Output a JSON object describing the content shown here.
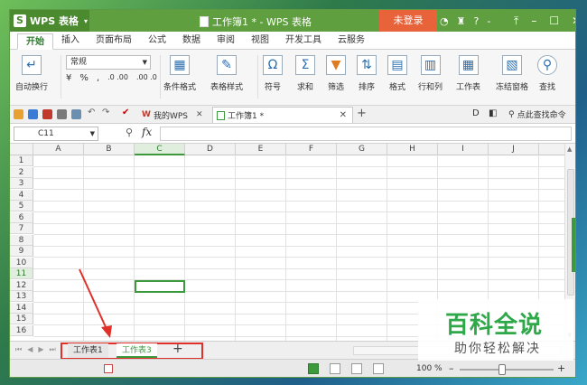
{
  "app": {
    "name": "WPS 表格",
    "logo": "S"
  },
  "title": {
    "text": "工作簿1 * - WPS 表格"
  },
  "login_button": "未登录",
  "title_icons": [
    "?",
    "-"
  ],
  "tabs": [
    "开始",
    "插入",
    "页面布局",
    "公式",
    "数据",
    "审阅",
    "视图",
    "开发工具",
    "云服务"
  ],
  "ribbon": {
    "wrap_text": "自动换行",
    "number_format": "常规",
    "number_buttons": [
      "%",
      "‚",
      ".0 .00",
      ".00 .0"
    ],
    "conditional": "条件格式",
    "table_style": "表格样式",
    "symbol": "符号",
    "sum": "求和",
    "filter": "筛选",
    "sort": "排序",
    "format": "格式",
    "row_col": "行和列",
    "sheet": "工作表",
    "freeze": "冻结窗格",
    "find": "查找"
  },
  "doc_tabs": {
    "wps_home": "我的WPS",
    "book": "工作簿1 *",
    "search": "点此查找命令"
  },
  "formula_bar": {
    "name_box": "C11",
    "fx": "fx"
  },
  "columns": [
    "A",
    "B",
    "C",
    "D",
    "E",
    "F",
    "G",
    "H",
    "I",
    "J"
  ],
  "rows": [
    "1",
    "2",
    "3",
    "4",
    "5",
    "6",
    "7",
    "8",
    "9",
    "10",
    "11",
    "12",
    "13",
    "14",
    "15",
    "16"
  ],
  "selected": {
    "column": "C",
    "row": "11"
  },
  "sheets": [
    "工作表1",
    "工作表3"
  ],
  "status": {
    "zoom": "100 %"
  },
  "zoom_level": 0.45,
  "watermark": {
    "title": "百科全说",
    "subtitle": "助你轻松解决"
  },
  "colors": {
    "accent": "#3c9a3c",
    "title_bg": "#5f9f3f",
    "login": "#e8623a",
    "highlight": "#e0302a"
  }
}
